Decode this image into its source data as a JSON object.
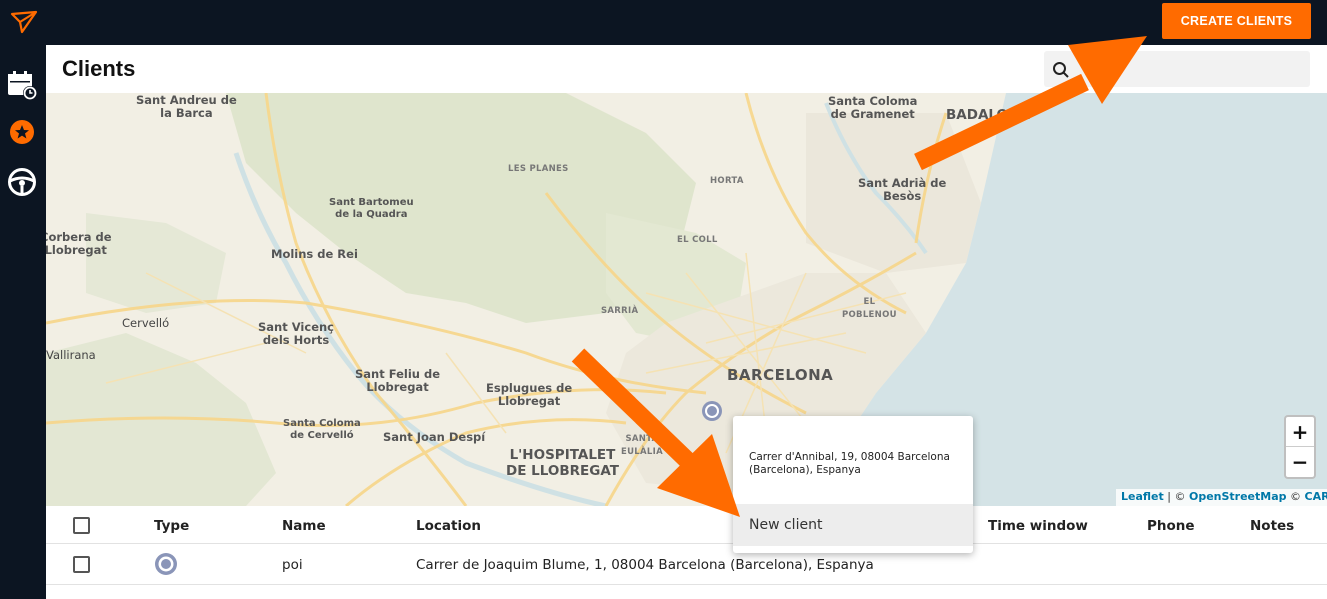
{
  "topbar": {
    "create_label": "CREATE CLIENTS"
  },
  "sidebar": {
    "items": [
      "calendar-clock-icon",
      "star-pin-icon",
      "steering-wheel-icon"
    ]
  },
  "header": {
    "title": "Clients",
    "search_placeholder": ""
  },
  "map": {
    "places": [
      {
        "name": "Sant Andreu de\nla Barca"
      },
      {
        "name": "Santa Coloma\nde Gramenet"
      },
      {
        "name": "BADALONA"
      },
      {
        "name": "HORTA"
      },
      {
        "name": "Sant Adrià de\nBesòs"
      },
      {
        "name": "LES PLANES"
      },
      {
        "name": "Sant Bartomeu\nde la Quadra"
      },
      {
        "name": "EL COLL"
      },
      {
        "name": "Corbera de\nLlobregat"
      },
      {
        "name": "Molins de Rei"
      },
      {
        "name": "EL\nPOBLENOU"
      },
      {
        "name": "SARRIÀ"
      },
      {
        "name": "Cervelló"
      },
      {
        "name": "Sant Vicenç\ndels Horts"
      },
      {
        "name": "Vallirana"
      },
      {
        "name": "BARCELONA"
      },
      {
        "name": "Sant Feliu de\nLlobregat"
      },
      {
        "name": "Esplugues de\nLlobregat"
      },
      {
        "name": "Santa Coloma\nde Cervelló"
      },
      {
        "name": "Sant Joan Despí"
      },
      {
        "name": "SANTA\nEULÀLIA"
      },
      {
        "name": "L'HOSPITALET\nDE LLOBREGAT"
      }
    ],
    "zoom_in": "+",
    "zoom_out": "−",
    "attribution": {
      "leaflet": "Leaflet",
      "sep1": " | © ",
      "osm": "OpenStreetMap",
      "sep2": " © ",
      "carto": "CARTO"
    }
  },
  "popup": {
    "address": "Carrer d'Annibal, 19, 08004 Barcelona (Barcelona), Espanya",
    "button": "New client"
  },
  "table": {
    "columns": {
      "type": "Type",
      "name": "Name",
      "location": "Location",
      "time_window": "Time window",
      "phone": "Phone",
      "notes": "Notes"
    },
    "rows": [
      {
        "type": "poi-icon",
        "name": "poi",
        "location": "Carrer de Joaquim Blume, 1, 08004 Barcelona (Barcelona), Espanya"
      }
    ]
  },
  "colors": {
    "accent": "#ff6b00",
    "dark": "#0c1522",
    "sea": "#d4e3e6"
  }
}
